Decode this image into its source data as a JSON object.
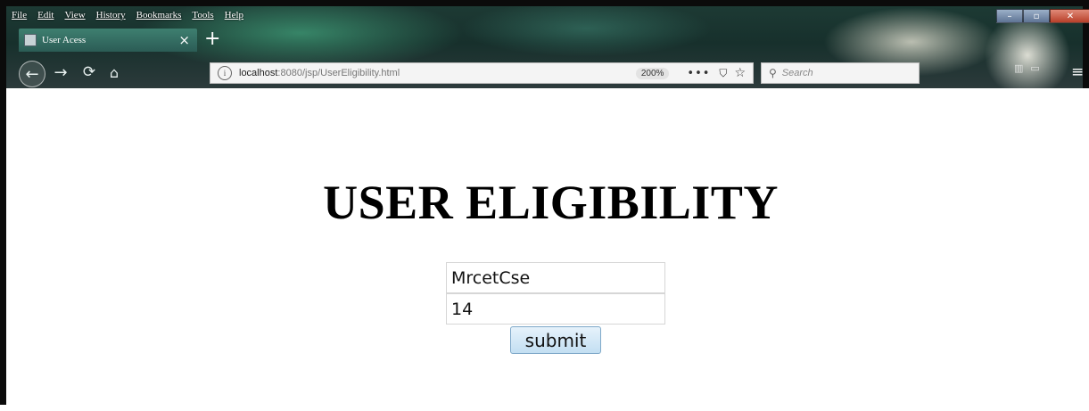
{
  "browser": {
    "menu": [
      "File",
      "Edit",
      "View",
      "History",
      "Bookmarks",
      "Tools",
      "Help"
    ],
    "tab_title": "User Acess",
    "tab_close": "×",
    "new_tab": "+",
    "nav_icons": [
      "back-arrow-icon",
      "forward-arrow-icon",
      "reload-icon",
      "home-icon"
    ],
    "url_host": "localhost",
    "url_path": ":8080/jsp/UserEligibility.html",
    "zoom": "200%",
    "more": "•••",
    "search_placeholder": "Search",
    "hamburger": "≡"
  },
  "page": {
    "heading": "USER ELIGIBILITY",
    "name_value": "MrcetCse",
    "age_value": "14",
    "submit_label": "submit"
  }
}
